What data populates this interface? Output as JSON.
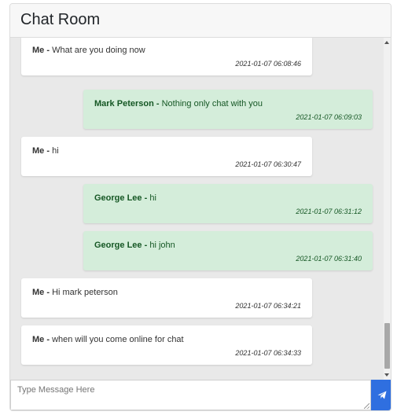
{
  "header": {
    "title": "Chat Room"
  },
  "messages": [
    {
      "sender": "Me",
      "text": "What are you doing now",
      "time": "2021-01-07 06:08:46",
      "side": "me"
    },
    {
      "sender": "Mark Peterson",
      "text": "Nothing only chat with you",
      "time": "2021-01-07 06:09:03",
      "side": "other"
    },
    {
      "sender": "Me",
      "text": "hi",
      "time": "2021-01-07 06:30:47",
      "side": "me"
    },
    {
      "sender": "George Lee",
      "text": "hi",
      "time": "2021-01-07 06:31:12",
      "side": "other"
    },
    {
      "sender": "George Lee",
      "text": "hi john",
      "time": "2021-01-07 06:31:40",
      "side": "other"
    },
    {
      "sender": "Me",
      "text": "Hi mark peterson",
      "time": "2021-01-07 06:34:21",
      "side": "me"
    },
    {
      "sender": "Me",
      "text": "when will you come online for chat",
      "time": "2021-01-07 06:34:33",
      "side": "me"
    }
  ],
  "separator": "-",
  "composer": {
    "placeholder": "Type Message Here",
    "value": "",
    "send_icon": "paper-plane-icon"
  },
  "colors": {
    "accent": "#2f6fe0",
    "my_bubble": "#ffffff",
    "other_bubble": "#d4edda",
    "other_text": "#155724",
    "chat_background": "#e9e9e9"
  }
}
